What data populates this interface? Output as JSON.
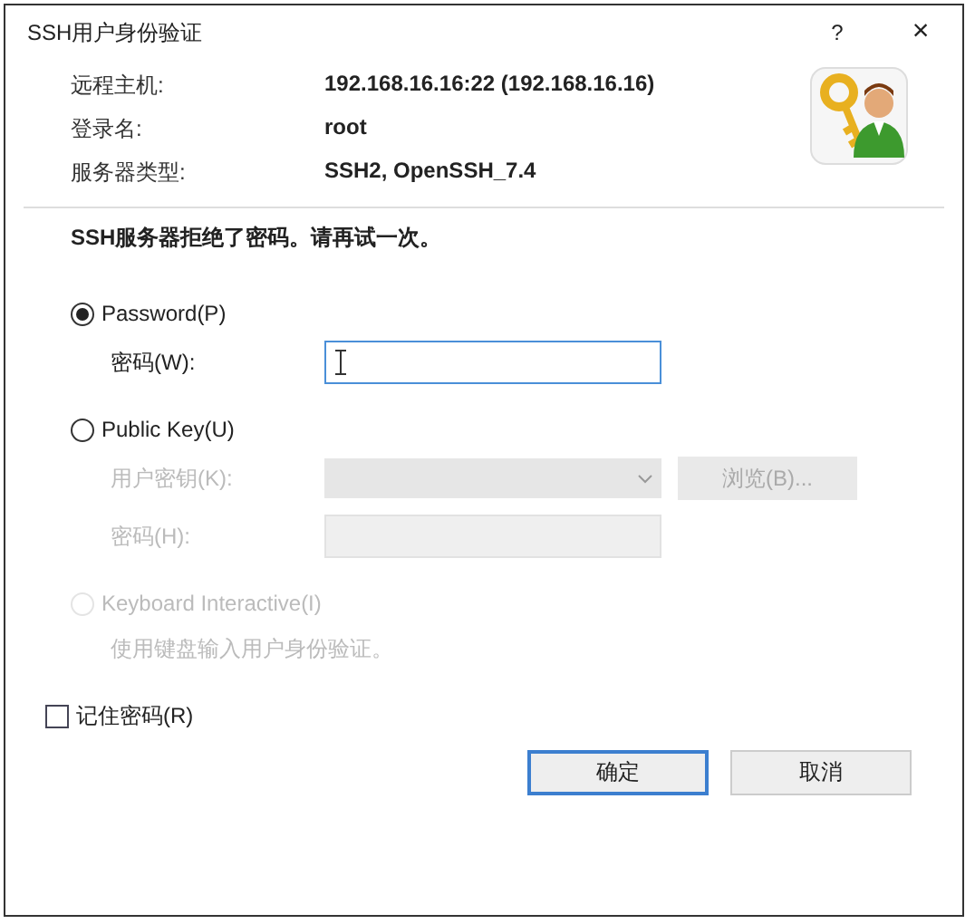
{
  "window": {
    "title": "SSH用户身份验证",
    "help": "?",
    "close": "×"
  },
  "info": [
    {
      "label": "远程主机:",
      "value": "192.168.16.16:22 (192.168.16.16)"
    },
    {
      "label": "登录名:",
      "value": "root"
    },
    {
      "label": "服务器类型:",
      "value": "SSH2, OpenSSH_7.4"
    }
  ],
  "message": "SSH服务器拒绝了密码。请再试一次。",
  "methods": [
    {
      "label": "Password(P)",
      "selected": true,
      "disabled": false,
      "fields": [
        {
          "label": "密码(W):",
          "kind": "input",
          "disabled": false,
          "focused": true
        }
      ]
    },
    {
      "label": "Public Key(U)",
      "selected": false,
      "disabled": false,
      "fields": [
        {
          "label": "用户密钥(K):",
          "kind": "combo",
          "disabled": true,
          "focused": false,
          "button": "浏览(B)..."
        },
        {
          "label": "密码(H):",
          "kind": "input",
          "disabled": true,
          "focused": false
        }
      ]
    },
    {
      "label": "Keyboard Interactive(I)",
      "selected": false,
      "disabled": true,
      "description": "使用键盘输入用户身份验证。"
    }
  ],
  "remember": {
    "label": "记住密码(R)",
    "checked": false
  },
  "buttons": [
    {
      "label": "确定",
      "default": true
    },
    {
      "label": "取消",
      "default": false
    }
  ]
}
